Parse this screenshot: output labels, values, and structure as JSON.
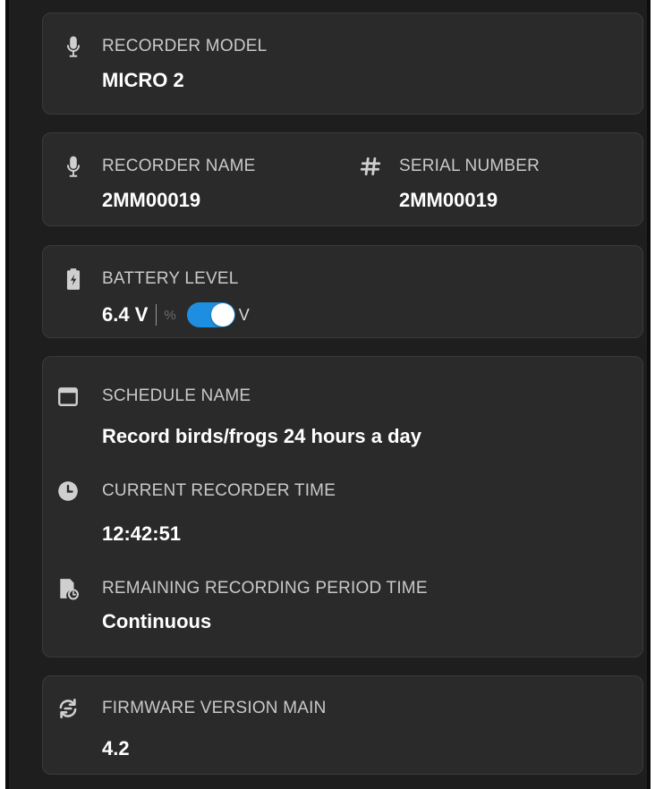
{
  "recorder_model": {
    "label": "RECORDER MODEL",
    "value": "MICRO 2",
    "icon": "microphone-icon"
  },
  "recorder_name": {
    "label": "RECORDER NAME",
    "value": "2MM00019",
    "icon": "microphone-icon"
  },
  "serial_number": {
    "label": "SERIAL NUMBER",
    "value": "2MM00019",
    "icon": "hash-icon"
  },
  "battery": {
    "label": "BATTERY LEVEL",
    "value": "6.4 V",
    "unit_percent": "%",
    "unit_volts": "V",
    "toggle_on": true,
    "icon": "battery-charging-icon"
  },
  "schedule": {
    "schedule_name": {
      "label": "SCHEDULE NAME",
      "value": "Record birds/frogs 24 hours a day",
      "icon": "calendar-icon"
    },
    "current_time": {
      "label": "CURRENT RECORDER TIME",
      "value": "12:42:51",
      "icon": "clock-icon"
    },
    "remaining_time": {
      "label": "REMAINING RECORDING PERIOD TIME",
      "value": "Continuous",
      "icon": "file-clock-icon"
    }
  },
  "firmware": {
    "label": "FIRMWARE VERSION MAIN",
    "value": "4.2",
    "icon": "sync-icon"
  },
  "colors": {
    "background": "#1e1e1e",
    "card": "#2a2a2a",
    "card_border": "#3a3a3a",
    "label": "#c9c9c9",
    "value": "#ffffff",
    "toggle_accent": "#1e8fe0"
  }
}
